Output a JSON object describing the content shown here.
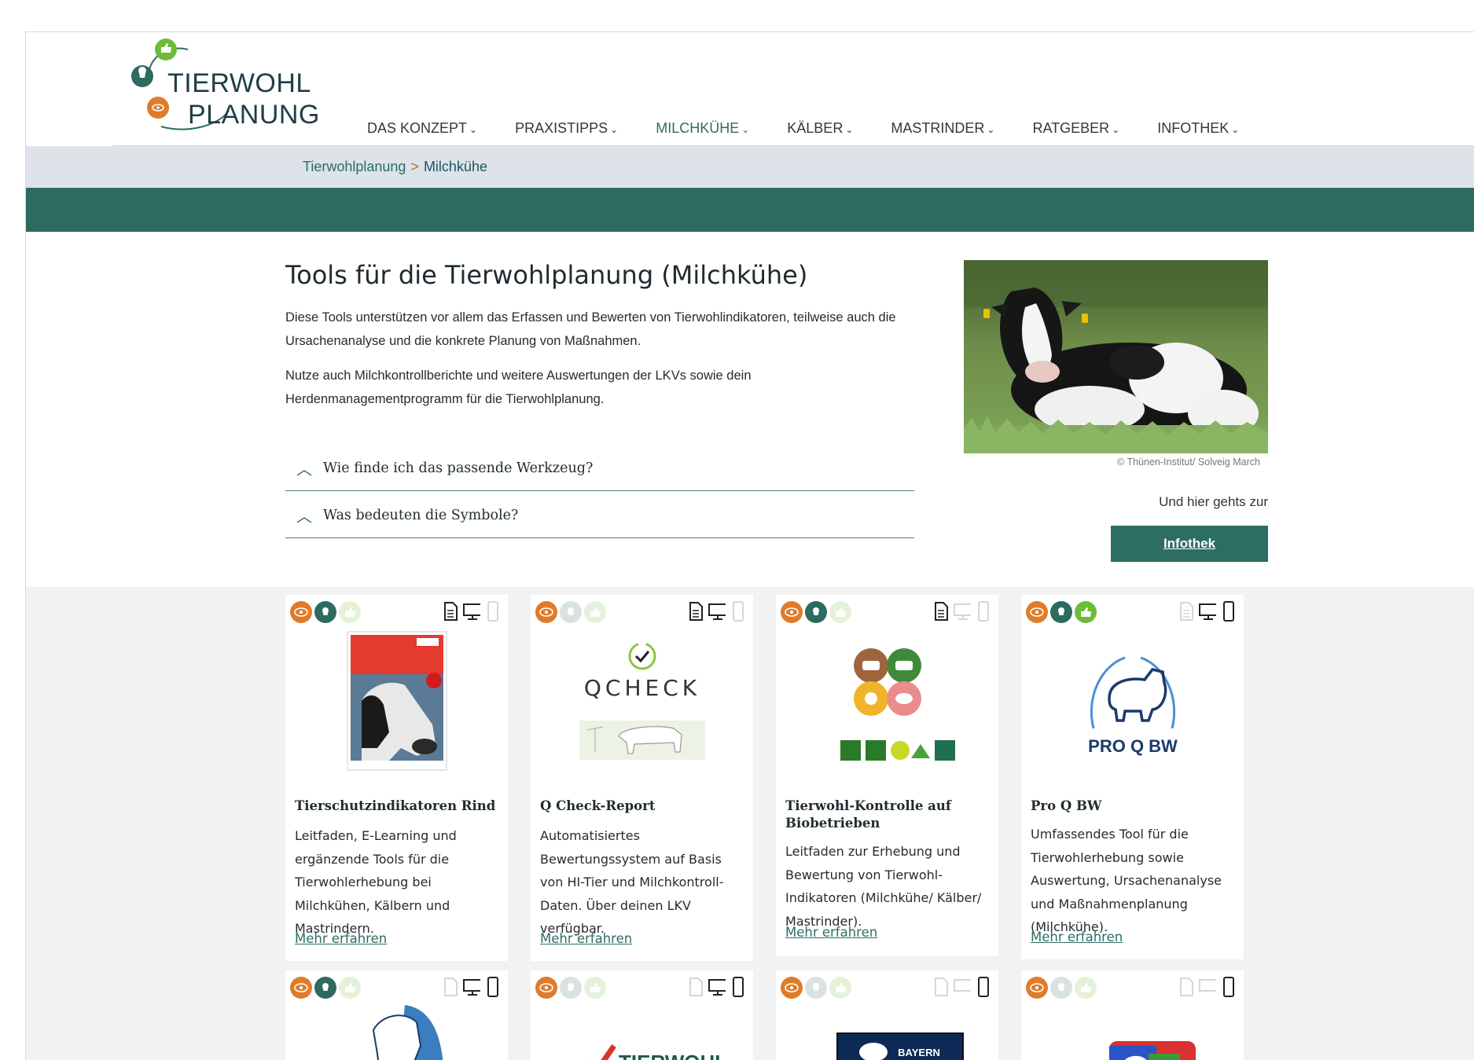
{
  "logo": {
    "line1": "TIERWOHL",
    "line2": "PLANUNG"
  },
  "nav": [
    {
      "label": "DAS KONZEPT",
      "active": false
    },
    {
      "label": "PRAXISTIPPS",
      "active": false
    },
    {
      "label": "MILCHKÜHE",
      "active": true
    },
    {
      "label": "KÄLBER",
      "active": false
    },
    {
      "label": "MASTRINDER",
      "active": false
    },
    {
      "label": "RATGEBER",
      "active": false
    },
    {
      "label": "INFOTHEK",
      "active": false
    }
  ],
  "breadcrumb": {
    "root": "Tierwohlplanung",
    "separator": ">",
    "current": "Milchkühe"
  },
  "intro": {
    "title": "Tools für die Tierwohlplanung (Milchkühe)",
    "p1": "Diese Tools unterstützen vor allem das Erfassen und Bewerten von Tierwohlindikatoren, teilweise auch die Ursachenanalyse und die konkrete Planung von Maßnahmen.",
    "p2": "Nutze auch Milchkontrollberichte und weitere Auswertungen der LKVs sowie dein Herdenmanagementprogramm für die Tierwohlplanung."
  },
  "accordion": [
    {
      "label": "Wie finde ich das passende Werkzeug?"
    },
    {
      "label": "Was bedeuten die Symbole?"
    }
  ],
  "hero": {
    "credit": "© Thünen-Institut/ Solveig March",
    "cta_text": "Und hier gehts zur",
    "cta_button": "Infothek"
  },
  "colors": {
    "accent": "#2d6b60",
    "orange": "#e07b2a",
    "green": "#6dbb3a",
    "crumbbar": "#dde3e8"
  },
  "cards": [
    {
      "title": "Tierschutzindikatoren Rind",
      "desc": "Leitfaden, E-Learning und ergänzende Tools für die Tierwohlerhebung bei Milchkühen, Kälbern und Mastrindern.",
      "more": "Mehr erfahren",
      "symbols": [
        true,
        true,
        false
      ],
      "devices": [
        true,
        true,
        false
      ],
      "thumb": "ktbl-booklet"
    },
    {
      "title": "Q Check-Report",
      "desc": "Automatisiertes Bewertungssystem auf Basis von HI-Tier und Milchkontroll-Daten. Über deinen LKV verfügbar.",
      "more": "Mehr erfahren",
      "symbols": [
        true,
        false,
        false
      ],
      "devices": [
        true,
        true,
        false
      ],
      "thumb": "qcheck",
      "thumb_text": "QCHECK"
    },
    {
      "title": "Tierwohl-Kontrolle auf Biobetrieben",
      "desc": "Leitfaden zur Erhebung und Bewertung von Tierwohl-Indikatoren (Milchkühe/ Kälber/ Mastrinder).",
      "more": "Mehr erfahren",
      "symbols": [
        true,
        true,
        false
      ],
      "devices": [
        true,
        false,
        false
      ],
      "thumb": "bio-logos"
    },
    {
      "title": "Pro Q BW",
      "desc": "Umfassendes Tool für die Tierwohlerhebung sowie Auswertung, Ursachenanalyse und Maßnahmenplanung (Milchkühe).",
      "more": "Mehr erfahren",
      "symbols": [
        true,
        true,
        true
      ],
      "devices": [
        false,
        true,
        true
      ],
      "thumb": "proq",
      "thumb_text": "PRO Q BW"
    },
    {
      "symbols": [
        true,
        true,
        false
      ],
      "devices": [
        false,
        true,
        true
      ],
      "thumb": "cow-shield"
    },
    {
      "symbols": [
        true,
        false,
        false
      ],
      "devices": [
        false,
        true,
        true
      ],
      "thumb": "tierwohlcheck",
      "thumb_text": "TIERWOHL"
    },
    {
      "symbols": [
        true,
        false,
        false
      ],
      "devices": [
        false,
        false,
        true
      ],
      "thumb": "lkv",
      "thumb_text": "BAYERN"
    },
    {
      "symbols": [
        true,
        false,
        false
      ],
      "devices": [
        false,
        false,
        true
      ],
      "thumb": "flag-cow"
    }
  ]
}
